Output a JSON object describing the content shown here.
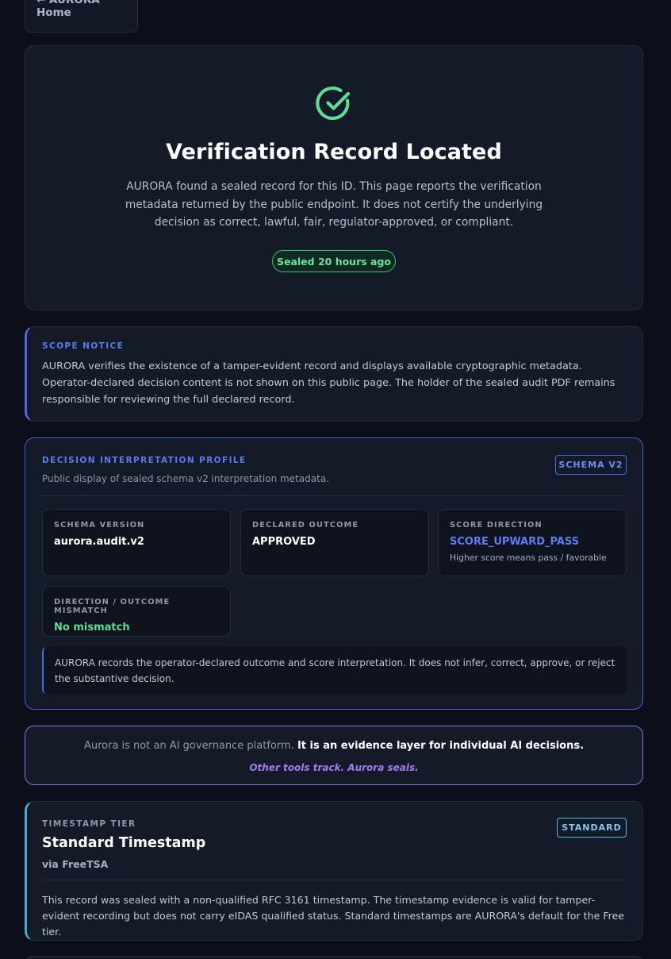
{
  "nav": {
    "back_label": "← AURORA Home"
  },
  "hero": {
    "icon": "check-circle-icon",
    "title": "Verification Record Located",
    "description": "AURORA found a sealed record for this ID. This page reports the verification metadata returned by the public endpoint. It does not certify the underlying decision as correct, lawful, fair, regulator-approved, or compliant.",
    "badge": "Sealed 20 hours ago"
  },
  "scope": {
    "eyebrow": "SCOPE NOTICE",
    "text": "AURORA verifies the existence of a tamper-evident record and displays available cryptographic metadata. Operator-declared decision content is not shown on this public page. The holder of the sealed audit PDF remains responsible for reviewing the full declared record."
  },
  "profile": {
    "eyebrow": "DECISION INTERPRETATION PROFILE",
    "subtitle": "Public display of sealed schema v2 interpretation metadata.",
    "pill": "SCHEMA V2",
    "fields": [
      {
        "label": "SCHEMA VERSION",
        "value": "aurora.audit.v2"
      },
      {
        "label": "DECLARED OUTCOME",
        "value": "APPROVED"
      },
      {
        "label": "SCORE DIRECTION",
        "value": "SCORE_UPWARD_PASS",
        "hint": "Higher score means pass / favorable"
      },
      {
        "label": "DIRECTION / OUTCOME MISMATCH",
        "value": "No mismatch"
      }
    ],
    "note": "AURORA records the operator-declared outcome and score interpretation. It does not infer, correct, approve, or reject the substantive decision."
  },
  "tagline": {
    "muted": "Aurora is not an AI governance platform.",
    "strong": "It is an evidence layer for individual AI decisions.",
    "italic": "Other tools track. Aurora seals."
  },
  "timestamp": {
    "eyebrow": "TIMESTAMP TIER",
    "title": "Standard Timestamp",
    "via": "via FreeTSA",
    "pill": "STANDARD",
    "text": "This record was sealed with a non-qualified RFC 3161 timestamp. The timestamp evidence is valid for tamper-evident recording but does not carry eIDAS qualified status. Standard timestamps are AURORA's default for the Free tier."
  },
  "colors": {
    "background": "#0c0f19",
    "accent_blue": "#5b7cf0",
    "success_green": "#5fdc93",
    "tagline_purple": "#9f7cf0",
    "timestamp_cyan": "#52b6ea"
  }
}
